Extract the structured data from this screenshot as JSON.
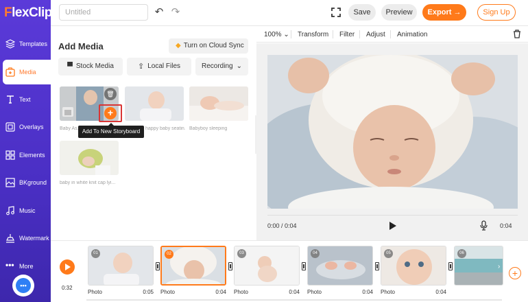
{
  "app": {
    "logo_f": "F",
    "logo_rest": "lexClip"
  },
  "sidebar": {
    "items": [
      {
        "label": "Templates",
        "icon": "layers-icon"
      },
      {
        "label": "Media",
        "icon": "media-icon"
      },
      {
        "label": "Text",
        "icon": "text-icon"
      },
      {
        "label": "Overlays",
        "icon": "overlay-icon"
      },
      {
        "label": "Elements",
        "icon": "elements-icon"
      },
      {
        "label": "BKground",
        "icon": "background-icon"
      },
      {
        "label": "Music",
        "icon": "music-icon"
      },
      {
        "label": "Watermark",
        "icon": "watermark-icon"
      },
      {
        "label": "More",
        "icon": "more-icon"
      }
    ],
    "active_index": 1
  },
  "topbar": {
    "title_placeholder": "Untitled",
    "save_label": "Save",
    "preview_label": "Preview",
    "export_label": "Export →",
    "signup_label": "Sign Up"
  },
  "panel": {
    "title": "Add Media",
    "cloud_sync_label": "Turn on Cloud Sync",
    "stock_media_label": "Stock Media",
    "local_files_label": "Local Files",
    "recording_label": "Recording",
    "media": [
      {
        "label": "Baby As..."
      },
      {
        "label": "happy baby seatin..."
      },
      {
        "label": "Babyboy sleeping"
      },
      {
        "label": "baby in white knit cap lyi..."
      }
    ],
    "tooltip": "Add To New Storyboard"
  },
  "preview": {
    "zoom": "100%",
    "tools": [
      "Transform",
      "Filter",
      "Adjust",
      "Animation"
    ],
    "time_current": "0:00 / 0:04",
    "duration": "0:04"
  },
  "timeline": {
    "total": "0:32",
    "clips": [
      {
        "num": "01",
        "label": "Photo",
        "dur": "0:05"
      },
      {
        "num": "02",
        "label": "Photo",
        "dur": "0:04"
      },
      {
        "num": "03",
        "label": "Photo",
        "dur": "0:04"
      },
      {
        "num": "04",
        "label": "Photo",
        "dur": "0:04"
      },
      {
        "num": "05",
        "label": "Photo",
        "dur": "0:04"
      },
      {
        "num": "06",
        "label": "",
        "dur": ""
      }
    ],
    "active_clip_index": 1
  },
  "colors": {
    "accent": "#ff7a1a",
    "sidebar": "#5b3ad9",
    "danger": "#d93535"
  }
}
